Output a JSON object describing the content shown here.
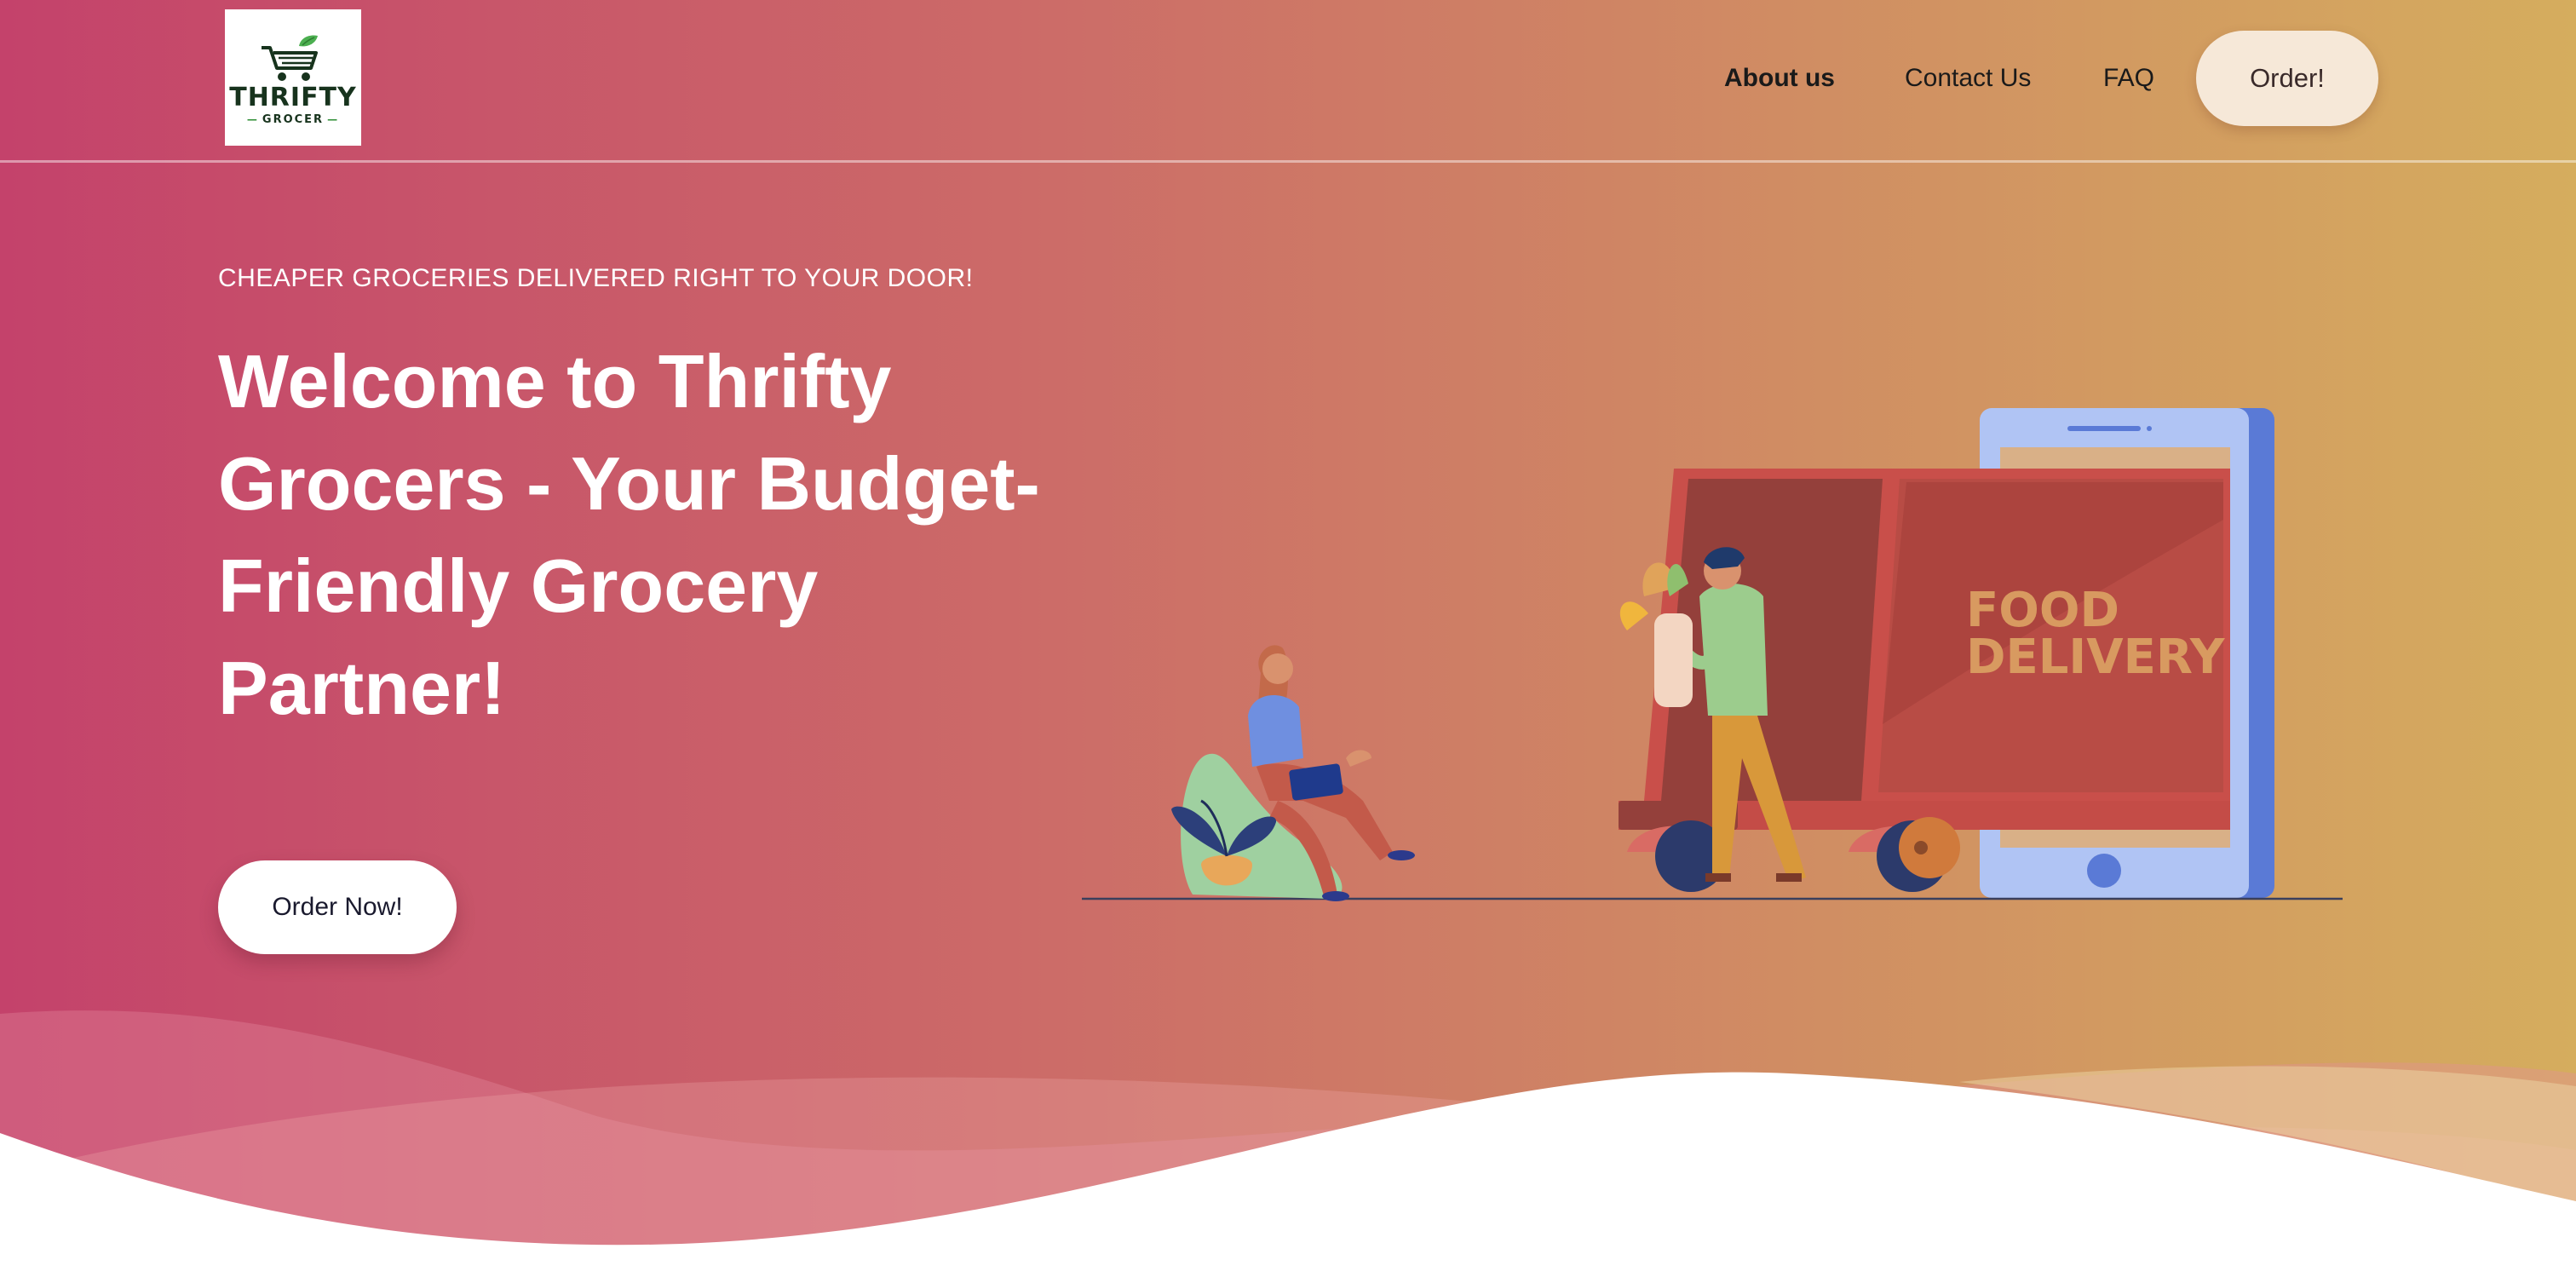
{
  "header": {
    "logo": {
      "word": "THRIFTY",
      "sub": "GROCER"
    },
    "nav": {
      "about": "About us",
      "contact": "Contact Us",
      "faq": "FAQ",
      "order": "Order!"
    }
  },
  "hero": {
    "tagline": "CHEAPER GROCERIES DELIVERED RIGHT TO YOUR DOOR!",
    "headline": "Welcome to Thrifty Grocers - Your Budget-Friendly Grocery Partner!",
    "cta": "Order Now!"
  },
  "illustration": {
    "truck_text_line1": "FOOD",
    "truck_text_line2": "DELIVERY"
  },
  "colors": {
    "gradient_start": "#c4426b",
    "gradient_end": "#d5ad5e",
    "button_bg": "#ffffff",
    "order_button_bg": "#f6e8d8",
    "logo_green": "#17331d"
  }
}
